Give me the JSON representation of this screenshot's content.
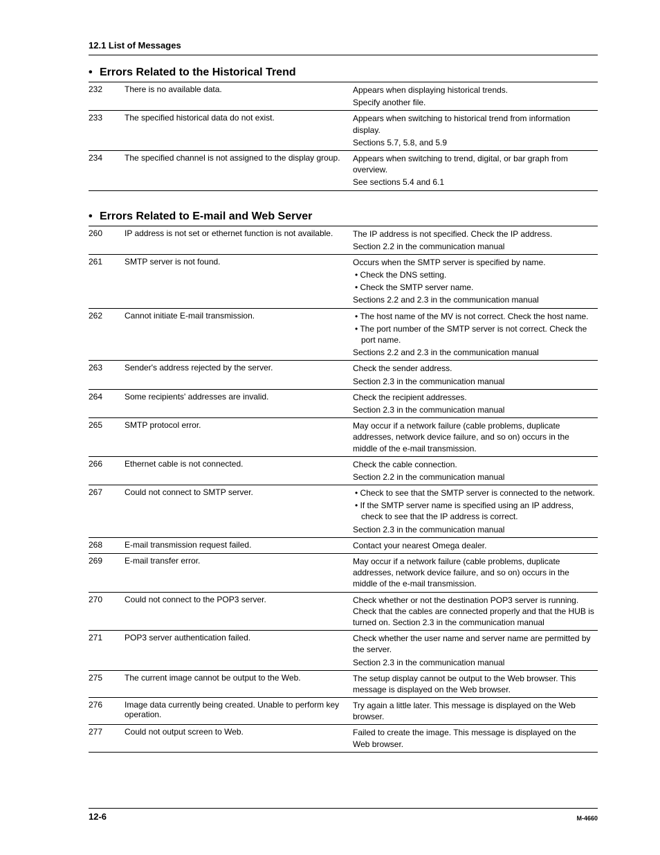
{
  "header": {
    "section_ref": "12.1  List of Messages"
  },
  "footer": {
    "page_num": "12-6",
    "doc_id": "M-4660"
  },
  "sections": [
    {
      "title": "Errors Related to the Historical Trend",
      "rows": [
        {
          "code": "232",
          "msg": "There is no available data.",
          "desc": [
            {
              "t": "Appears when displaying historical trends."
            },
            {
              "t": "Specify another file."
            }
          ]
        },
        {
          "code": "233",
          "msg": "The specified historical data do not exist.",
          "desc": [
            {
              "t": "Appears when switching to historical trend from information display."
            },
            {
              "t": "Sections 5.7, 5.8, and 5.9"
            }
          ]
        },
        {
          "code": "234",
          "msg": "The specified channel is not assigned to the display group.",
          "desc": [
            {
              "t": "Appears when switching to trend, digital, or bar graph from overview."
            },
            {
              "t": "See sections 5.4 and 6.1"
            }
          ]
        }
      ]
    },
    {
      "title": "Errors Related to E-mail and Web Server",
      "rows": [
        {
          "code": "260",
          "msg": "IP address is not set or ethernet function is not available.",
          "desc": [
            {
              "t": "The IP address is not specified. Check the IP address."
            },
            {
              "t": "Section 2.2 in the communication manual"
            }
          ]
        },
        {
          "code": "261",
          "msg": "SMTP server is not found.",
          "desc": [
            {
              "t": "Occurs when the SMTP server is specified by name."
            },
            {
              "t": "Check the DNS setting.",
              "bullet": true
            },
            {
              "t": "Check the SMTP server name.",
              "bullet": true
            },
            {
              "t": "Sections 2.2 and 2.3 in the communication manual"
            }
          ]
        },
        {
          "code": "262",
          "msg": "Cannot initiate E-mail transmission.",
          "desc": [
            {
              "t": "The host name of the MV is not correct. Check the host name.",
              "bullet": true
            },
            {
              "t": "The port number of the SMTP server is not correct. Check the port name.",
              "bullet": true
            },
            {
              "t": "Sections 2.2 and 2.3 in the communication manual"
            }
          ]
        },
        {
          "code": "263",
          "msg": "Sender's address rejected by the server.",
          "desc": [
            {
              "t": "Check the sender address."
            },
            {
              "t": "Section 2.3 in the communication manual"
            }
          ]
        },
        {
          "code": "264",
          "msg": "Some recipients' addresses are invalid.",
          "desc": [
            {
              "t": "Check the recipient addresses."
            },
            {
              "t": "Section 2.3 in the communication manual"
            }
          ]
        },
        {
          "code": "265",
          "msg": "SMTP protocol error.",
          "desc": [
            {
              "t": "May occur if a network failure (cable problems, duplicate addresses, network device failure, and so on) occurs in the middle of the e-mail transmission."
            }
          ]
        },
        {
          "code": "266",
          "msg": "Ethernet cable is not connected.",
          "desc": [
            {
              "t": "Check the cable connection."
            },
            {
              "t": "Section 2.2 in the communication manual"
            }
          ]
        },
        {
          "code": "267",
          "msg": "Could not connect to SMTP server.",
          "desc": [
            {
              "t": "Check to see that the SMTP server is connected to the network.",
              "bullet": true
            },
            {
              "t": "If the SMTP server name is specified using an IP address, check to see that the IP address is correct.",
              "bullet": true
            },
            {
              "t": "Section 2.3 in the communication manual"
            }
          ]
        },
        {
          "code": "268",
          "msg": "E-mail transmission request failed.",
          "desc": [
            {
              "t": "Contact your nearest Omega dealer."
            }
          ]
        },
        {
          "code": "269",
          "msg": "E-mail transfer error.",
          "desc": [
            {
              "t": "May occur if a network failure (cable problems, duplicate addresses, network device failure, and so on) occurs in the middle of the e-mail transmission."
            }
          ]
        },
        {
          "code": "270",
          "msg": "Could not connect to the POP3 server.",
          "desc": [
            {
              "t": "Check whether or not the destination POP3 server is running. Check that the cables are connected properly and that the HUB is turned on. Section 2.3 in the communication manual"
            }
          ]
        },
        {
          "code": "271",
          "msg": "POP3 server authentication failed.",
          "desc": [
            {
              "t": "Check whether the user name and server name are permitted by the server."
            },
            {
              "t": "Section 2.3 in the communication manual"
            }
          ]
        },
        {
          "code": "275",
          "msg": "The current image cannot be output to the Web.",
          "desc": [
            {
              "t": "The setup display cannot be output to the Web browser. This message is displayed on the Web browser."
            }
          ]
        },
        {
          "code": "276",
          "msg": "Image data currently being created. Unable to perform key operation.",
          "desc": [
            {
              "t": "Try again a little later. This message is displayed on the Web browser."
            }
          ]
        },
        {
          "code": "277",
          "msg": "Could not output screen to Web.",
          "desc": [
            {
              "t": "Failed to create the image. This message is displayed on the Web browser."
            }
          ]
        }
      ]
    }
  ]
}
